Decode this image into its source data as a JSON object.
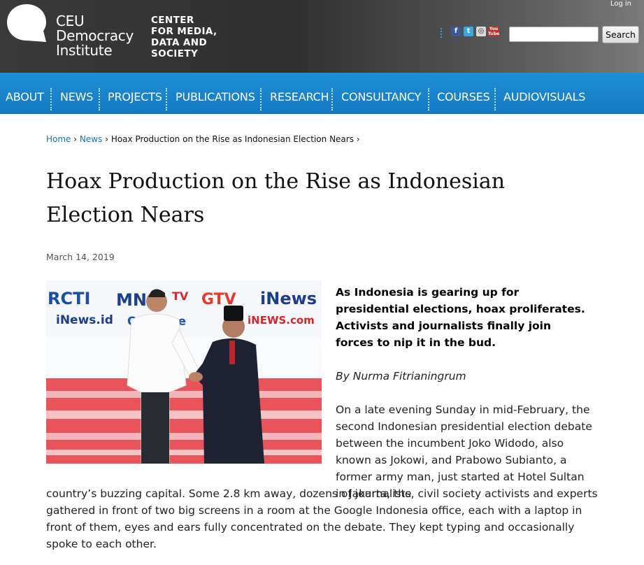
{
  "header": {
    "logo_ceu": "CEU\nDemocracy\nInstitute",
    "logo_center": "CENTER\nFOR MEDIA,\nDATA AND\nSOCIETY",
    "login_label": "Log in",
    "search": {
      "value": "",
      "button_label": "Search"
    },
    "social": {
      "facebook": "f",
      "twitter": "t",
      "instagram": "◎",
      "youtube": "You\nTube"
    }
  },
  "nav": {
    "items": [
      "ABOUT",
      "NEWS",
      "PROJECTS",
      "PUBLICATIONS",
      "RESEARCH",
      "CONSULTANCY",
      "COURSES",
      "AUDIOVISUALS"
    ]
  },
  "breadcrumb": {
    "home": "Home",
    "news": "News",
    "current": "Hoax Production on the Rise as Indonesian Election Nears"
  },
  "article": {
    "title": "Hoax Production on the Rise as Indonesian Election Nears",
    "date": "March 14, 2019",
    "lead": "As Indonesia is gearing up for presidential elections, hoax proliferates. Activists and journalists finally join forces to nip it in the bud.",
    "byline": "By Nurma Fitrianingrum",
    "para1": "On a late evening Sunday in mid-February, the second Indonesian presidential election debate between the incumbent Joko Widodo, also known as Jokowi, and Prabowo Subianto, a former army man, just started at Hotel Sultan in Jakarta, the",
    "para2": "country’s buzzing capital. Some 2.8 km away, dozens of journalists, civil society activists and experts gathered in front of two big screens in a room at the Google Indonesia office, each with a laptop in front of them, eyes and ears fully concentrated on the debate. They kept typing and occasionally spoke to each other.",
    "photo_logos": {
      "rcti": "RCTI",
      "mnc": "MNC",
      "tv": "TV",
      "gtv": "GTV",
      "inews": "iNews",
      "inews_id": "iNews.id",
      "okezone": "OKezone",
      "inews_com": "iNEWS.com"
    }
  },
  "colors": {
    "nav_blue": "#1479c2",
    "link_blue": "#1572b6",
    "header_dark": "#2f2f2f"
  }
}
